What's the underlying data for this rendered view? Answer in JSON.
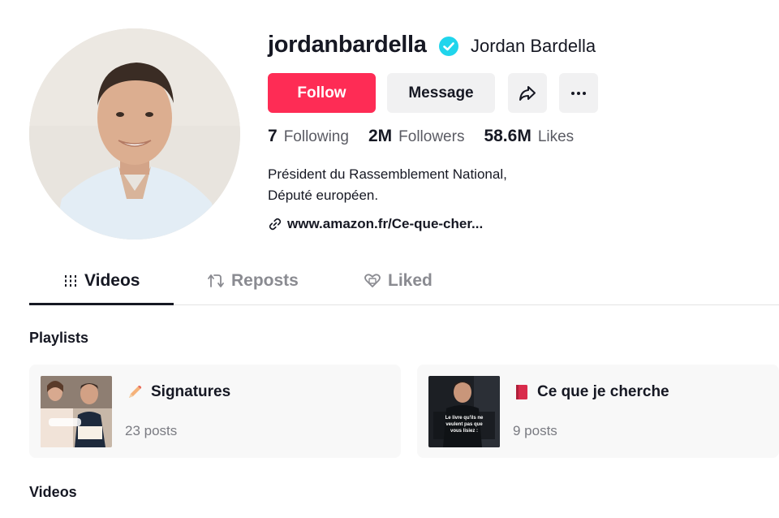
{
  "profile": {
    "username": "jordanbardella",
    "display_name": "Jordan Bardella",
    "verified": true
  },
  "actions": {
    "follow_label": "Follow",
    "message_label": "Message",
    "share_icon": "share-arrow-icon",
    "more_icon": "more-dots-icon"
  },
  "stats": {
    "following_count": "7",
    "following_label": "Following",
    "followers_count": "2M",
    "followers_label": "Followers",
    "likes_count": "58.6M",
    "likes_label": "Likes"
  },
  "bio": {
    "line1": "Président du Rassemblement National,",
    "line2": "Député européen.",
    "link": "www.amazon.fr/Ce-que-cher..."
  },
  "tabs": [
    {
      "label": "Videos",
      "icon": "grid-icon",
      "active": true
    },
    {
      "label": "Reposts",
      "icon": "repost-icon",
      "active": false
    },
    {
      "label": "Liked",
      "icon": "liked-heart-icon",
      "active": false
    }
  ],
  "sections": {
    "playlists_title": "Playlists",
    "videos_title": "Videos"
  },
  "playlists": [
    {
      "emoji": "pencil-icon",
      "title": "Signatures",
      "count": "23 posts"
    },
    {
      "emoji": "book-icon",
      "title": "Ce que je cherche",
      "count": "9 posts"
    }
  ],
  "thumbnail_caption": {
    "playlist2": "Le livre qu'ils ne veulent pas que vous lisiez :"
  },
  "colors": {
    "accent": "#fe2c55",
    "verified": "#20d5ec",
    "button_bg": "#f1f1f2",
    "card_bg": "#f8f8f8"
  }
}
